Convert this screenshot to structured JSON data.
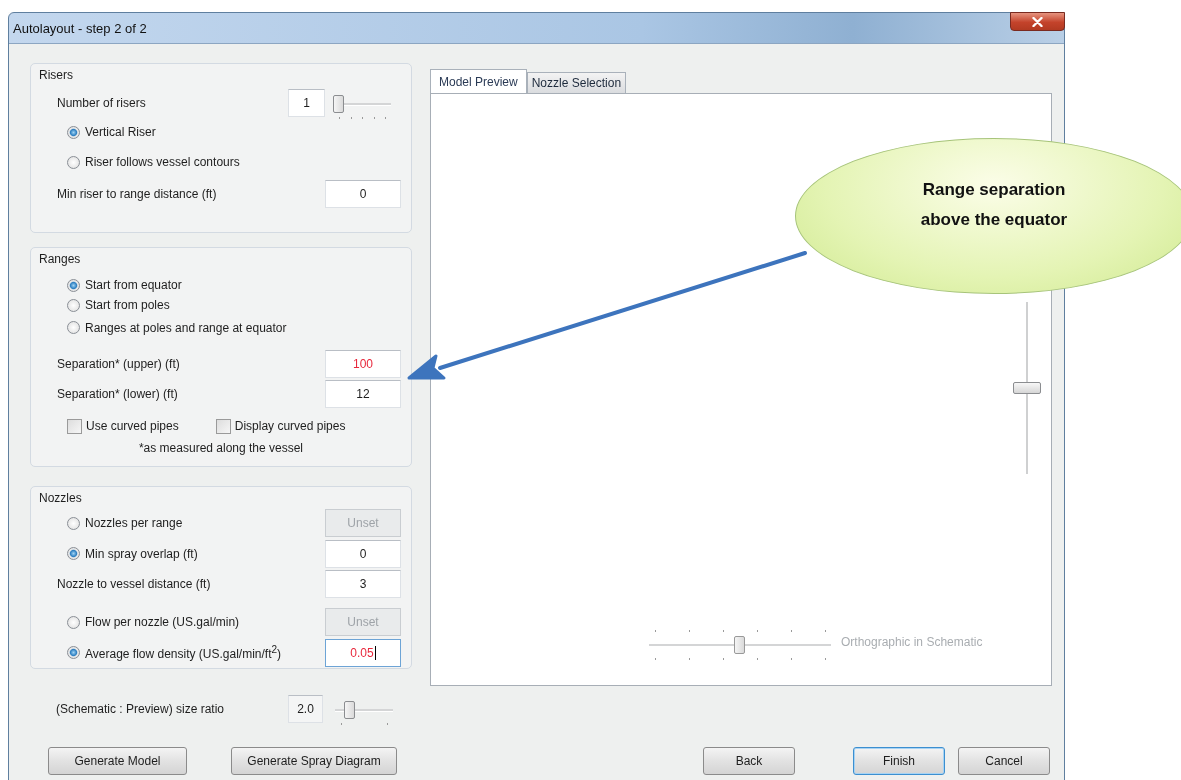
{
  "window": {
    "title": "Autolayout - step 2 of 2"
  },
  "risers": {
    "title": "Risers",
    "count": {
      "label": "Number of risers",
      "value": "1",
      "level": 0
    },
    "options": [
      {
        "label": "Vertical Riser",
        "selected": true
      },
      {
        "label": "Riser follows vessel contours",
        "selected": false
      }
    ],
    "distance": {
      "label": "Min riser  to range distance (ft)",
      "value": "0"
    }
  },
  "ranges": {
    "title": "Ranges",
    "options": [
      {
        "label": "Start from equator",
        "selected": true
      },
      {
        "label": "Start from poles",
        "selected": false
      },
      {
        "label": "Ranges at poles and range at equator",
        "selected": false
      }
    ],
    "fields": [
      {
        "label": "Separation* (upper) (ft)",
        "value": "100",
        "highlighted": true
      },
      {
        "label": "Separation* (lower) (ft)",
        "value": "12",
        "highlighted": false
      }
    ],
    "checkboxes": [
      {
        "label": "Use curved pipes",
        "checked": false
      },
      {
        "label": "Display curved pipes",
        "checked": false
      }
    ],
    "note": "*as measured along the vessel"
  },
  "nozzles": {
    "title": "Nozzles",
    "groups": [
      [
        {
          "kind": "radio-button",
          "label": "Nozzles per range",
          "selected": false,
          "button": "Unset"
        },
        {
          "kind": "radio-field",
          "label": "Min spray overlap (ft)",
          "selected": true,
          "value": "0",
          "highlighted": false,
          "focused": false
        },
        {
          "kind": "field",
          "label": "Nozzle to vessel distance (ft)",
          "value": "3"
        }
      ],
      [
        {
          "kind": "radio-button",
          "label": "Flow per nozzle (US.gal/min)",
          "selected": false,
          "button": "Unset"
        },
        {
          "kind": "radio-field",
          "label": "Average flow density (US.gal/min/ft$^{2}$)",
          "selected": true,
          "value": "0.05",
          "highlighted": true,
          "focused": true
        }
      ]
    ]
  },
  "size_ratio": {
    "label": "(Schematic : Preview) size ratio",
    "value": "2.0",
    "level": 0.2
  },
  "left_buttons": [
    "Generate Model",
    "Generate Spray Diagram"
  ],
  "tabs": [
    {
      "label": "Model Preview",
      "selected": true
    },
    {
      "label": "Nozzle Selection",
      "selected": false
    }
  ],
  "preview": {
    "vertical_slider": {
      "level": 0.5
    },
    "orthographic": {
      "label": "Orthographic in Schematic",
      "level": 0.5,
      "disabled": true
    }
  },
  "buttons": [
    {
      "label": "Back",
      "default": false
    },
    {
      "label": "Finish",
      "default": true
    },
    {
      "label": "Cancel",
      "default": false
    }
  ],
  "callout": {
    "text": "Range separation above the equator"
  }
}
